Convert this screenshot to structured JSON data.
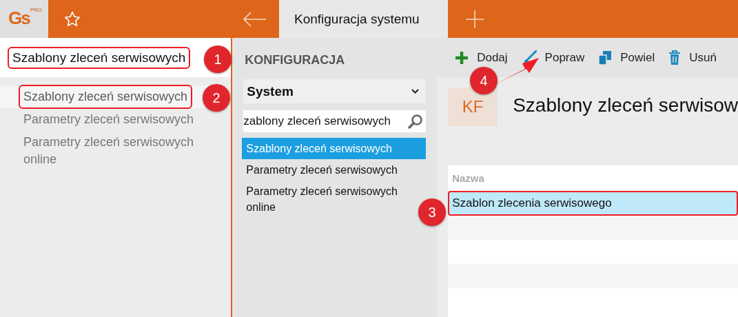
{
  "app": {
    "logo": "Gs",
    "logo_badge": "PRO"
  },
  "tabs": [
    {
      "label": "Konfiguracja systemu",
      "selected": true
    }
  ],
  "left_panel": {
    "heading": "Szablony zleceń serwisowych",
    "items": [
      {
        "label": "Szablony zleceń serwisowych",
        "selected": true
      },
      {
        "label": "Parametry zleceń serwisowych",
        "selected": false
      },
      {
        "label": "Parametry zleceń serwisowych online",
        "selected": false
      }
    ]
  },
  "config": {
    "title": "KONFIGURACJA",
    "dropdown": "System",
    "search": "zablony zleceń serwisowych",
    "items": [
      {
        "label": "Szablony zleceń serwisowych",
        "selected": true
      },
      {
        "label": "Parametry zleceń serwisowych",
        "selected": false
      },
      {
        "label": "Parametry zleceń serwisowych online",
        "selected": false
      }
    ]
  },
  "toolbar": [
    {
      "kind": "add",
      "label": "Dodaj"
    },
    {
      "kind": "edit",
      "label": "Popraw"
    },
    {
      "kind": "copy",
      "label": "Powiel"
    },
    {
      "kind": "delete",
      "label": "Usuń"
    }
  ],
  "record": {
    "avatar": "KF",
    "title": "Szablony zleceń serwisow"
  },
  "table": {
    "columns": [
      "Nazwa"
    ],
    "rows": [
      {
        "cells": [
          "Szablon zlecenia serwisowego"
        ],
        "selected": true
      }
    ]
  },
  "callouts": [
    {
      "number": "1"
    },
    {
      "number": "2"
    },
    {
      "number": "3"
    },
    {
      "number": "4"
    }
  ]
}
